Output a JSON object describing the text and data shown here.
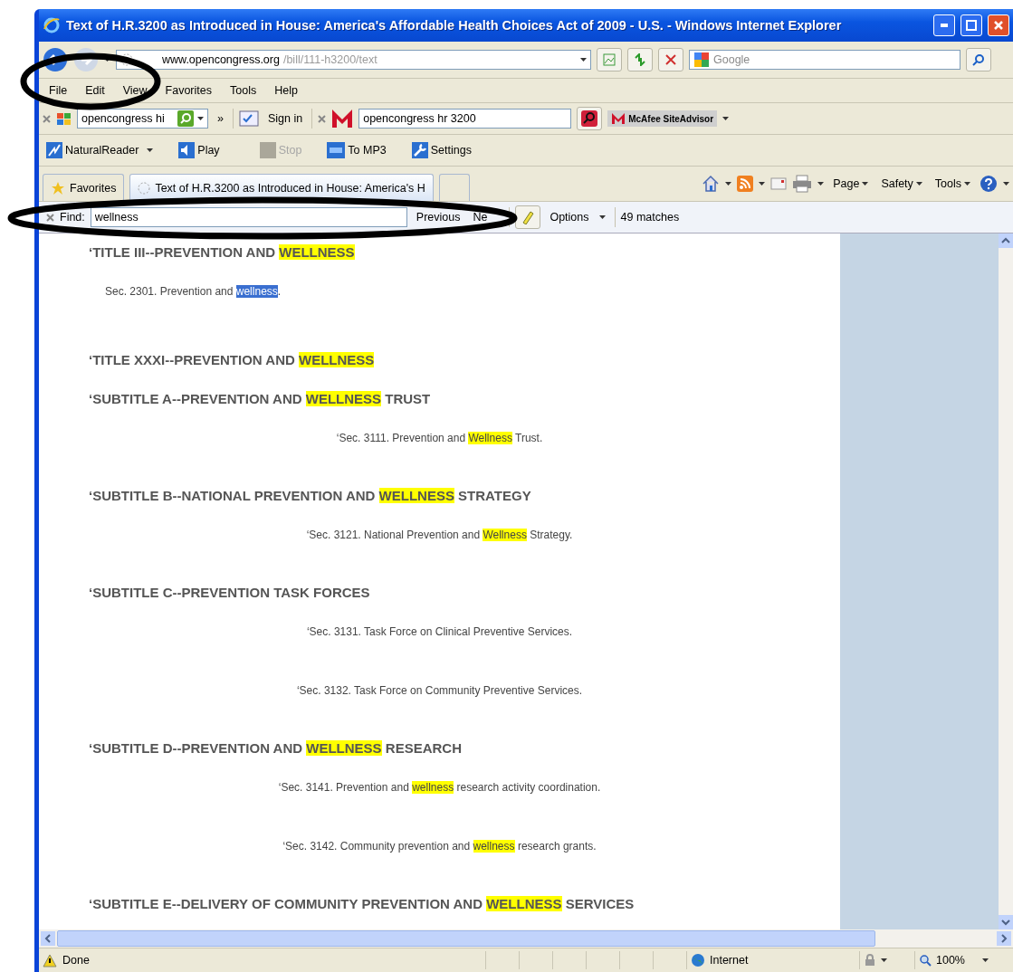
{
  "window": {
    "title": "Text of H.R.3200 as Introduced in House: America's Affordable Health Choices Act of 2009 - U.S. - Windows Internet Explorer"
  },
  "address_bar": {
    "url_host": "www.opencongress.org",
    "url_path": "/bill/111-h3200/text"
  },
  "search_box": {
    "placeholder": "Google"
  },
  "menu": [
    "File",
    "Edit",
    "View",
    "Favorites",
    "Tools",
    "Help"
  ],
  "toolbar_1": {
    "windows_search_value": "opencongress hi",
    "chevron": "»",
    "sign_in": "Sign in",
    "mcafee_search_value": "opencongress hr 3200",
    "siteadvisor": "McAfee SiteAdvisor"
  },
  "toolbar_2": [
    {
      "label": "NaturalReader",
      "disabled": false,
      "dropdown": true
    },
    {
      "label": "Play",
      "disabled": false,
      "dropdown": false
    },
    {
      "label": "Stop",
      "disabled": true,
      "dropdown": false
    },
    {
      "label": "To MP3",
      "disabled": false,
      "dropdown": false
    },
    {
      "label": "Settings",
      "disabled": false,
      "dropdown": false
    }
  ],
  "tabs": [
    {
      "label": "Favorites",
      "selected": false
    },
    {
      "label": "Text of H.R.3200 as Introduced in House: America's H",
      "selected": true
    }
  ],
  "command_bar": [
    "Page",
    "Safety",
    "Tools"
  ],
  "find_bar": {
    "label": "Find:",
    "value": "wellness",
    "previous": "Previous",
    "next": "Ne",
    "options": "Options",
    "matches": "49 matches"
  },
  "content": [
    {
      "kind": "heading",
      "parts": [
        {
          "text": "‘TITLE III--PREVENTION AND ",
          "highlighted": false,
          "selected": false
        },
        {
          "text": "WELLNESS",
          "highlighted": true,
          "selected": false
        }
      ]
    },
    {
      "kind": "indent",
      "parts": [
        {
          "text": "Sec. 2301. Prevention and ",
          "highlighted": false,
          "selected": false
        },
        {
          "text": "wellness",
          "highlighted": true,
          "selected": true
        },
        {
          "text": ".",
          "highlighted": false,
          "selected": false
        }
      ]
    },
    {
      "kind": "heading",
      "parts": [
        {
          "text": "‘TITLE XXXI--PREVENTION AND ",
          "highlighted": false,
          "selected": false
        },
        {
          "text": "WELLNESS",
          "highlighted": true,
          "selected": false
        }
      ]
    },
    {
      "kind": "heading",
      "parts": [
        {
          "text": "‘SUBTITLE A--PREVENTION AND ",
          "highlighted": false,
          "selected": false
        },
        {
          "text": "WELLNESS",
          "highlighted": true,
          "selected": false
        },
        {
          "text": " TRUST",
          "highlighted": false,
          "selected": false
        }
      ]
    },
    {
      "kind": "center",
      "parts": [
        {
          "text": "‘Sec. 3111. Prevention and ",
          "highlighted": false,
          "selected": false
        },
        {
          "text": "Wellness",
          "highlighted": true,
          "selected": false
        },
        {
          "text": " Trust.",
          "highlighted": false,
          "selected": false
        }
      ]
    },
    {
      "kind": "heading",
      "parts": [
        {
          "text": "‘SUBTITLE B--NATIONAL PREVENTION AND ",
          "highlighted": false,
          "selected": false
        },
        {
          "text": "WELLNESS",
          "highlighted": true,
          "selected": false
        },
        {
          "text": " STRATEGY",
          "highlighted": false,
          "selected": false
        }
      ]
    },
    {
      "kind": "center",
      "parts": [
        {
          "text": "‘Sec. 3121. National Prevention and ",
          "highlighted": false,
          "selected": false
        },
        {
          "text": "Wellness",
          "highlighted": true,
          "selected": false
        },
        {
          "text": " Strategy.",
          "highlighted": false,
          "selected": false
        }
      ]
    },
    {
      "kind": "heading",
      "parts": [
        {
          "text": "‘SUBTITLE C--PREVENTION TASK FORCES",
          "highlighted": false,
          "selected": false
        }
      ]
    },
    {
      "kind": "center",
      "parts": [
        {
          "text": "‘Sec. 3131. Task Force on Clinical Preventive Services.",
          "highlighted": false,
          "selected": false
        }
      ]
    },
    {
      "kind": "center",
      "parts": [
        {
          "text": "‘Sec. 3132. Task Force on Community Preventive Services.",
          "highlighted": false,
          "selected": false
        }
      ]
    },
    {
      "kind": "heading",
      "parts": [
        {
          "text": "‘SUBTITLE D--PREVENTION AND ",
          "highlighted": false,
          "selected": false
        },
        {
          "text": "WELLNESS",
          "highlighted": true,
          "selected": false
        },
        {
          "text": " RESEARCH",
          "highlighted": false,
          "selected": false
        }
      ]
    },
    {
      "kind": "center",
      "parts": [
        {
          "text": "‘Sec. 3141. Prevention and ",
          "highlighted": false,
          "selected": false
        },
        {
          "text": "wellness",
          "highlighted": true,
          "selected": false
        },
        {
          "text": " research activity coordination.",
          "highlighted": false,
          "selected": false
        }
      ]
    },
    {
      "kind": "center",
      "parts": [
        {
          "text": "‘Sec. 3142. Community prevention and ",
          "highlighted": false,
          "selected": false
        },
        {
          "text": "wellness",
          "highlighted": true,
          "selected": false
        },
        {
          "text": " research grants.",
          "highlighted": false,
          "selected": false
        }
      ]
    },
    {
      "kind": "heading",
      "parts": [
        {
          "text": "‘SUBTITLE E--DELIVERY OF COMMUNITY PREVENTION AND ",
          "highlighted": false,
          "selected": false
        },
        {
          "text": "WELLNESS",
          "highlighted": true,
          "selected": false
        },
        {
          "text": " SERVICES",
          "highlighted": false,
          "selected": false
        }
      ]
    }
  ],
  "status_bar": {
    "status": "Done",
    "zone": "Internet",
    "zoom": "100%"
  }
}
